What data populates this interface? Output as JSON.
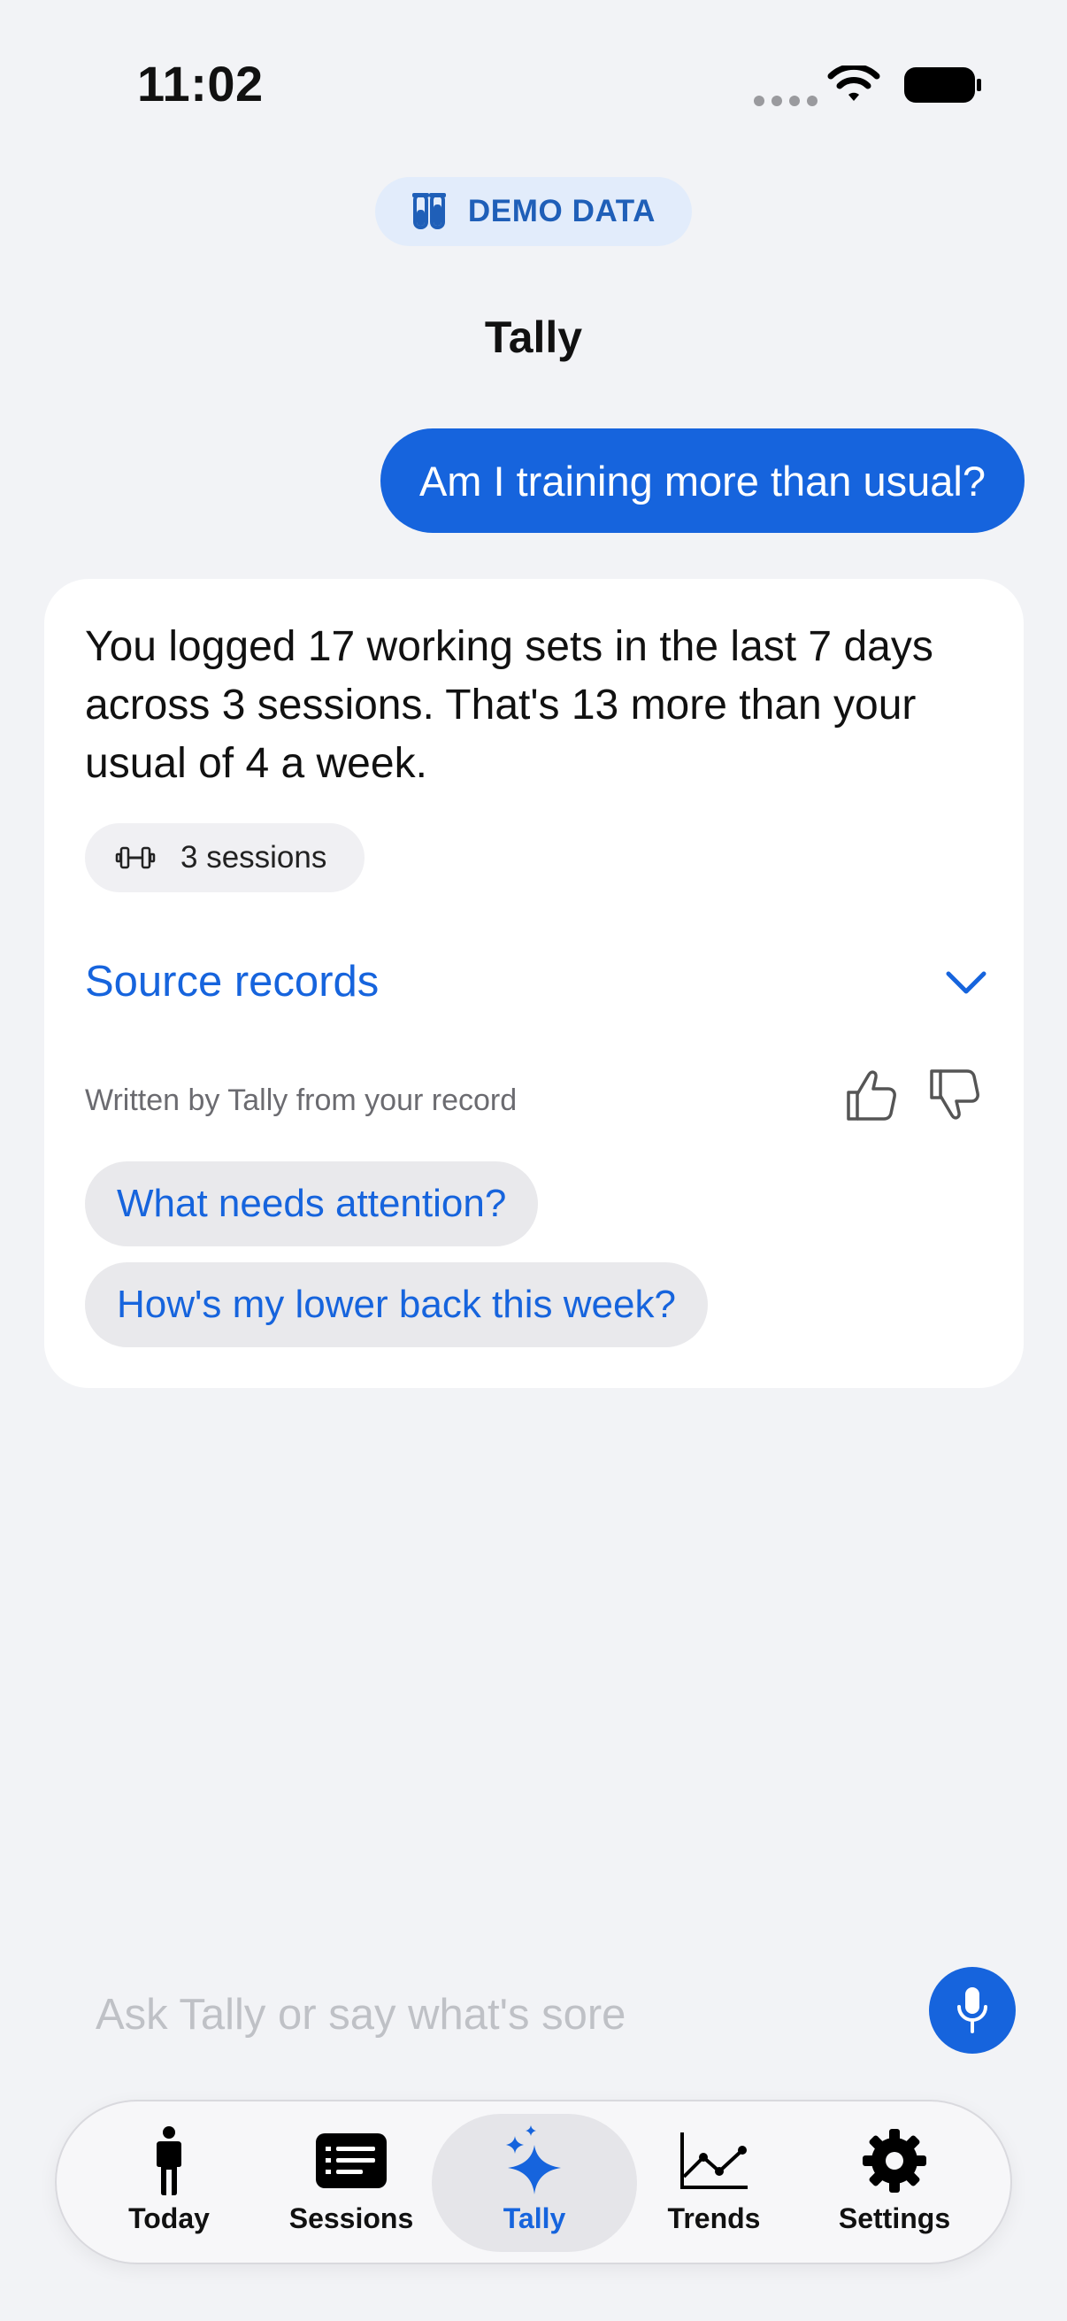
{
  "status_bar": {
    "time": "11:02"
  },
  "demo_badge": {
    "label": "DEMO DATA",
    "icon": "test-tubes-icon"
  },
  "header": {
    "title": "Tally"
  },
  "conversation": {
    "user_message": "Am I training more than usual?",
    "answer": {
      "text": "You logged 17 working sets in the last 7 days across 3 sessions. That's 13 more than your usual of 4 a week.",
      "chip_label": "3 sessions",
      "chip_icon": "dumbbell-icon",
      "source_records_label": "Source records",
      "attribution": "Written by Tally from your record"
    },
    "suggestions": [
      "What needs attention?",
      "How's my lower back this week?"
    ]
  },
  "composer": {
    "placeholder": "Ask Tally or say what's sore",
    "value": ""
  },
  "tab_bar": {
    "active": "Tally",
    "tabs": [
      {
        "label": "Today",
        "icon": "person-standing-icon"
      },
      {
        "label": "Sessions",
        "icon": "list-card-icon"
      },
      {
        "label": "Tally",
        "icon": "sparkles-icon"
      },
      {
        "label": "Trends",
        "icon": "line-chart-icon"
      },
      {
        "label": "Settings",
        "icon": "gear-icon"
      }
    ]
  },
  "colors": {
    "accent": "#1664dd",
    "background": "#f2f3f6",
    "card": "#ffffff",
    "demo_badge_bg": "#e2ecfb",
    "demo_badge_text": "#1f5fb8"
  }
}
